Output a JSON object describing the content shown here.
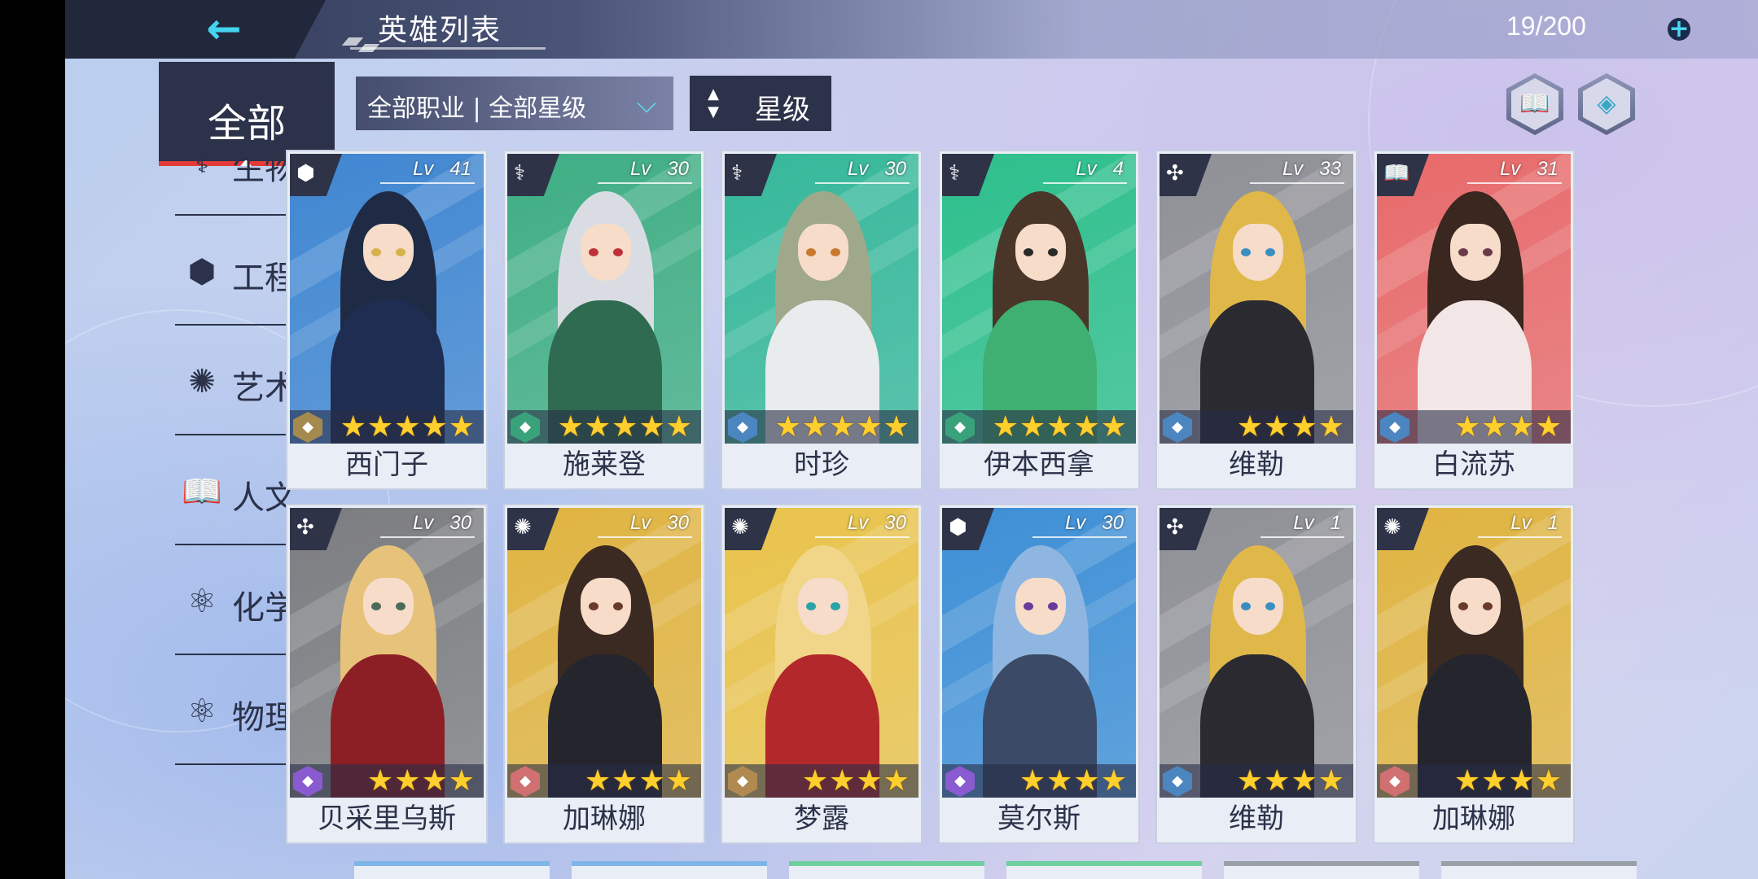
{
  "header": {
    "title": "英雄列表",
    "count": "19/200",
    "back_icon": "←",
    "plus_icon": "+"
  },
  "sidebar": {
    "all_label": "全部",
    "items": [
      {
        "label": "生物",
        "icon": "dna-icon",
        "glyph": "⚕"
      },
      {
        "label": "工程",
        "icon": "engineering-icon",
        "glyph": "⬢"
      },
      {
        "label": "艺术",
        "icon": "art-icon",
        "glyph": "✺"
      },
      {
        "label": "人文",
        "icon": "book-icon",
        "glyph": "📖"
      },
      {
        "label": "化学",
        "icon": "molecule-icon",
        "glyph": "⚛"
      },
      {
        "label": "物理",
        "icon": "atom-icon",
        "glyph": "⚛"
      }
    ]
  },
  "toolbar": {
    "filter_label": "全部职业 | 全部星级",
    "sort_label": "星级"
  },
  "cards": [
    {
      "name": "西门子",
      "level": "41",
      "stars": "★★★★★",
      "bg": "#3f86d1",
      "hair": "#1f2b45",
      "body": "#1f2d52",
      "eye": "#d7b24a",
      "badge": "⬢",
      "role": "#a58a4f"
    },
    {
      "name": "施莱登",
      "level": "30",
      "stars": "★★★★★",
      "bg": "#3fae84",
      "hair": "#d9dde3",
      "body": "#2f6b50",
      "eye": "#c0303a",
      "badge": "⚕",
      "role": "#3aa27a"
    },
    {
      "name": "时珍",
      "level": "30",
      "stars": "★★★★★",
      "bg": "#36b89a",
      "hair": "#9fa88a",
      "body": "#e8ecec",
      "eye": "#c8792d",
      "badge": "⚕",
      "role": "#4c86c0"
    },
    {
      "name": "伊本西拿",
      "level": "4",
      "stars": "★★★★★",
      "bg": "#2dbf8c",
      "hair": "#4a3629",
      "body": "#3fb071",
      "eye": "#2a2a2a",
      "badge": "⚕",
      "role": "#3aa27a"
    },
    {
      "name": "维勒",
      "level": "33",
      "stars": "★★★★",
      "bg": "#8f9096",
      "hair": "#e0b84a",
      "body": "#2a2a30",
      "eye": "#3a8fc0",
      "badge": "✣",
      "role": "#4c86c0"
    },
    {
      "name": "白流苏",
      "level": "31",
      "stars": "★★★★",
      "bg": "#e86a6a",
      "hair": "#3a2720",
      "body": "#f2e6e6",
      "eye": "#6b3a4a",
      "badge": "📖",
      "role": "#4c86c0"
    },
    {
      "name": "贝采里乌斯",
      "level": "30",
      "stars": "★★★★",
      "bg": "#7c7d80",
      "hair": "#e7c27a",
      "body": "#8c1f25",
      "eye": "#4d6b5a",
      "badge": "✣",
      "role": "#8a5ad0"
    },
    {
      "name": "加琳娜",
      "level": "30",
      "stars": "★★★★",
      "bg": "#e0b441",
      "hair": "#3b2a22",
      "body": "#25252d",
      "eye": "#6a3a2a",
      "badge": "✺",
      "role": "#d07070"
    },
    {
      "name": "梦露",
      "level": "30",
      "stars": "★★★★",
      "bg": "#e9c34b",
      "hair": "#f1d68a",
      "body": "#b3282b",
      "eye": "#2aa2a8",
      "badge": "✺",
      "role": "#b08a50"
    },
    {
      "name": "莫尔斯",
      "level": "30",
      "stars": "★★★★",
      "bg": "#3e8fd6",
      "hair": "#8fb6e0",
      "body": "#3b4a66",
      "eye": "#6a3a9a",
      "badge": "⬢",
      "role": "#8a5ad0"
    },
    {
      "name": "维勒",
      "level": "1",
      "stars": "★★★★",
      "bg": "#8f9096",
      "hair": "#e0b84a",
      "body": "#2a2a30",
      "eye": "#3a8fc0",
      "badge": "✣",
      "role": "#4c86c0"
    },
    {
      "name": "加琳娜",
      "level": "1",
      "stars": "★★★★",
      "bg": "#e0b441",
      "hair": "#3b2a22",
      "body": "#25252d",
      "eye": "#6a3a2a",
      "badge": "✺",
      "role": "#d07070"
    }
  ]
}
